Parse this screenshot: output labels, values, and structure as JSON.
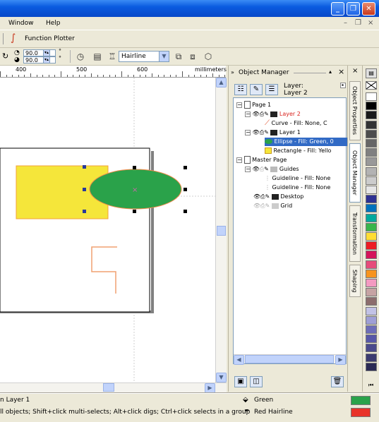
{
  "menu": {
    "window": "Window",
    "help": "Help"
  },
  "toolbar1": {
    "function_plotter": "Function Plotter"
  },
  "toolbar2": {
    "angle1": "90.0",
    "angle2": "90.0",
    "outline_width": "Hairline"
  },
  "ruler": {
    "labels": [
      "400",
      "500",
      "600"
    ],
    "units": "millimeters"
  },
  "docker": {
    "title": "Object Manager",
    "layer_label_line1": "Layer:",
    "layer_label_line2": "Layer 2",
    "tree": {
      "page1": "Page 1",
      "layer2": "Layer 2",
      "curve": "Curve - Fill: None, C",
      "layer1": "Layer 1",
      "ellipse": "Ellipse - Fill: Green, 0",
      "rectangle": "Rectangle - Fill: Yello",
      "master_page": "Master Page",
      "guides": "Guides",
      "guideline1": "Guideline - Fill: None",
      "guideline2": "Guideline - Fill: None",
      "desktop": "Desktop",
      "grid": "Grid"
    }
  },
  "tabs": [
    "Object Properties",
    "Object Manager",
    "Transformation",
    "Shaping"
  ],
  "palette_colors": [
    "#ffffff",
    "#000000",
    "#1a1a1a",
    "#333333",
    "#4d4d4d",
    "#666666",
    "#808080",
    "#999999",
    "#b3b3b3",
    "#cccccc",
    "#e6e6e6",
    "#2e3192",
    "#0072bc",
    "#00a99d",
    "#39b54a",
    "#ffdd33",
    "#ed1c24",
    "#d4145a",
    "#e64c7a",
    "#f7941d",
    "#f49ac1",
    "#c6a3a3",
    "#8c6d6d",
    "#c2c2e6",
    "#9f9fd6",
    "#6d6db8",
    "#5757a8",
    "#4a4a8c",
    "#3b3b70",
    "#2a2a55"
  ],
  "status": {
    "line1": "n Layer 1",
    "line2": "ll objects; Shift+click multi-selects; Alt+click digs; Ctrl+click selects in a group",
    "fill_name": "Green",
    "outline_name": "Red  Hairline",
    "fill_color": "#2aa24a",
    "outline_color": "#e8332a"
  },
  "colors": {
    "title_blue": "#0a5be0",
    "rect_fill": "#f5e63a",
    "ellipse_fill": "#2aa24a",
    "selection_blue": "#316ac5"
  }
}
